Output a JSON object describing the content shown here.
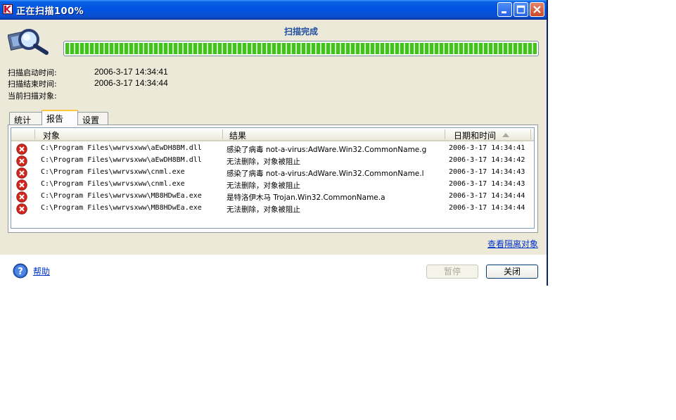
{
  "window": {
    "title": "正在扫描100%"
  },
  "scan": {
    "status": "扫描完成",
    "progress_percent": 100,
    "start_label": "扫描启动时间:",
    "start_value": "2006-3-17 14:34:41",
    "end_label": "扫描结束时间:",
    "end_value": "2006-3-17 14:34:44",
    "current_label": "当前扫描对象:"
  },
  "tabs": [
    {
      "label": "统计"
    },
    {
      "label": "报告"
    },
    {
      "label": "设置"
    }
  ],
  "report": {
    "columns": [
      "对象",
      "结果",
      "日期和时间"
    ],
    "rows": [
      {
        "object": "C:\\Program Files\\wwrvsxww\\aEwDH8BM.dll",
        "result": "感染了病毒 not-a-virus:AdWare.Win32.CommonName.g",
        "datetime": "2006-3-17 14:34:41"
      },
      {
        "object": "C:\\Program Files\\wwrvsxww\\aEwDH8BM.dll",
        "result": "无法删除，对象被阻止",
        "datetime": "2006-3-17 14:34:42"
      },
      {
        "object": "C:\\Program Files\\wwrvsxww\\cnml.exe",
        "result": "感染了病毒 not-a-virus:AdWare.Win32.CommonName.l",
        "datetime": "2006-3-17 14:34:43"
      },
      {
        "object": "C:\\Program Files\\wwrvsxww\\cnml.exe",
        "result": "无法删除，对象被阻止",
        "datetime": "2006-3-17 14:34:43"
      },
      {
        "object": "C:\\Program Files\\wwrvsxww\\MB8HDwEa.exe",
        "result": "是特洛伊木马 Trojan.Win32.CommonName.a",
        "datetime": "2006-3-17 14:34:44"
      },
      {
        "object": "C:\\Program Files\\wwrvsxww\\MB8HDwEa.exe",
        "result": "无法删除，对象被阻止",
        "datetime": "2006-3-17 14:34:44"
      }
    ]
  },
  "links": {
    "quarantine": "查看隔离对象",
    "help": "帮助"
  },
  "buttons": {
    "pause": "暂停",
    "close": "关闭"
  },
  "icons": {
    "row_status": "error-x-icon",
    "help": "help-question-icon",
    "logo": "magnifier-scan-icon"
  },
  "colors": {
    "titlebar": "#0054e3",
    "progress": "#44c21c",
    "error": "#d0281f",
    "link": "#0033cc",
    "status_text": "#1f4ea0"
  }
}
